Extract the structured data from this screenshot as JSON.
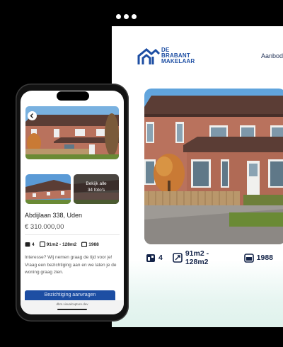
{
  "desktop": {
    "logo_line1": "DE",
    "logo_line2": "BRABANT",
    "logo_line3": "MAKELAAR",
    "nav_item": "Aanbod",
    "specs": {
      "rooms": "4",
      "area": "91m2 - 128m2",
      "year": "1988"
    }
  },
  "phone": {
    "photo_overlay_line1": "Bekijk alle",
    "photo_overlay_line2": "34 foto's",
    "address": "Abdijlaan 338, Uden",
    "price": "€ 310.000,00",
    "specs": {
      "rooms": "4",
      "area": "91m2 - 128m2",
      "year": "1988"
    },
    "description": "Interesse? Wij nemen graag de tijd voor je! Vraag een bezichtiging aan en we laten je de woning graag zien.",
    "cta_label": "Bezichtiging aanvragen",
    "url": "dbm.visualcapture.dev"
  },
  "colors": {
    "brand_blue": "#1d4ea3",
    "text_dark": "#142449",
    "background": "#000000"
  }
}
